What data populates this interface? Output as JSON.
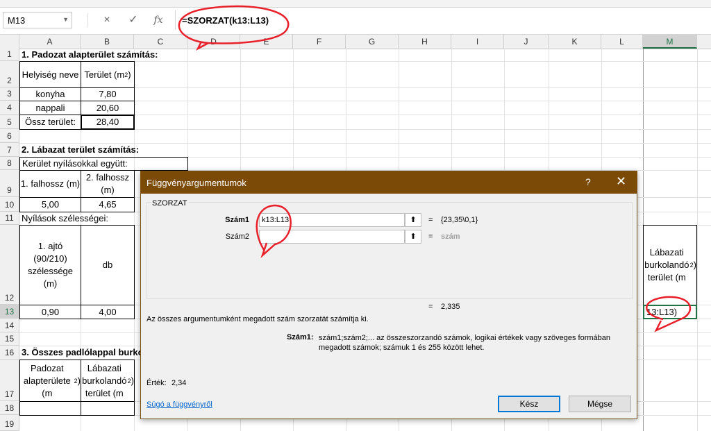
{
  "formula_bar": {
    "name_box": "M13",
    "cancel_icon": "×",
    "enter_icon": "✓",
    "fx_label": "fx",
    "formula": "=SZORZAT(k13:L13)"
  },
  "columns": [
    "A",
    "B",
    "C",
    "D",
    "E",
    "F",
    "G",
    "H",
    "I",
    "J",
    "K",
    "L",
    "M"
  ],
  "selected_column": "M",
  "rows": [
    "1",
    "2",
    "3",
    "4",
    "5",
    "6",
    "7",
    "8",
    "9",
    "10",
    "11",
    "12",
    "13",
    "14",
    "15",
    "16",
    "17",
    "18",
    "19"
  ],
  "cells": {
    "A1": "1. Padozat alapterület számítás:",
    "A2": "Helyiség neve",
    "B2": "Terület (m",
    "A3": "konyha",
    "B3": "7,80",
    "A4": "nappali",
    "B4": "20,60",
    "A5": "Össz terület:",
    "B5": "28,40",
    "A7": "2. Lábazat terület számítás:",
    "A8": "Kerület nyílásokkal együtt:",
    "A9": "1. falhossz (m)",
    "B9": "2. falhossz (m)",
    "A10": "5,00",
    "B10": "4,65",
    "A11": "Nyílások szélességei:",
    "A12": "1. ajtó (90/210) szélessége (m)",
    "B12": "db",
    "M12": "Lábazati burkolandó terület (m",
    "A13": "0,90",
    "B13": "4,00",
    "M13": "13:L13)",
    "A16": "3. Összes padlólappal burkol",
    "A17": "Padozat alapterülete (m",
    "B17": "Lábazati burkolandó terület (m",
    "sup2": "2"
  },
  "dialog": {
    "title": "Függvényargumentumok",
    "help": "?",
    "close": "✕",
    "function_name": "SZORZAT",
    "args": [
      {
        "label": "Szám1",
        "value": "k13:L13",
        "result": "{23,35\\0,1}"
      },
      {
        "label": "Szám2",
        "value": "",
        "result": "szám"
      }
    ],
    "equals": "=",
    "formula_result": "2,335",
    "description": "Az összes argumentumként megadott szám szorzatát számítja ki.",
    "arg_help_label": "Szám1:",
    "arg_help_text": "szám1;szám2;... az összeszorzandó számok, logikai értékek vagy szöveges formában megadott számok; számuk 1 és 255 között lehet.",
    "value_label": "Érték:",
    "value": "2,34",
    "help_link": "Súgó a függvényről",
    "ok": "Kész",
    "cancel": "Mégse"
  },
  "colors": {
    "dialog_title": "#7b4a07",
    "annotation": "#e8202a",
    "accent": "#217346"
  }
}
